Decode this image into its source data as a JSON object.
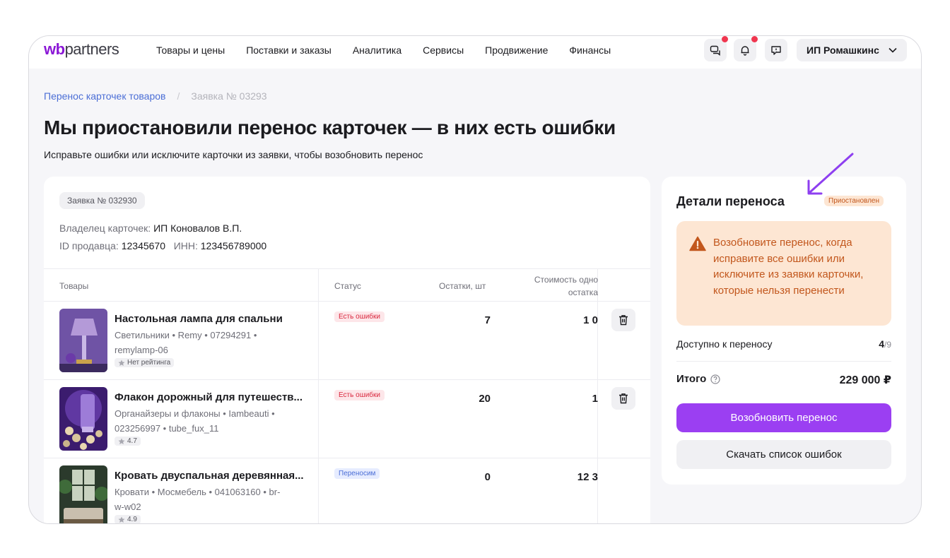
{
  "header": {
    "logo_wb": "wb",
    "logo_partners": "partners",
    "nav": [
      "Товары и цены",
      "Поставки и заказы",
      "Аналитика",
      "Сервисы",
      "Продвижение",
      "Финансы"
    ],
    "user_name": "ИП Ромашкинс",
    "icons": [
      "chat-icon",
      "bell-icon",
      "support-icon",
      "chevron-down-icon"
    ],
    "notification_color": "#f0364f"
  },
  "breadcrumb": {
    "parent": "Перенос карточек товаров",
    "separator": "/",
    "current": "Заявка № 03293"
  },
  "page": {
    "title": "Мы приостановили перенос карточек — в них есть ошибки",
    "subtitle": "Исправьте ошибки или исключите карточки из заявки, чтобы возобновить перенос"
  },
  "request": {
    "badge": "Заявка № 032930",
    "owner_label": "Владелец карточек:",
    "owner_value": "ИП Коновалов В.П.",
    "seller_id_label": "ID продавца:",
    "seller_id_value": "12345670",
    "inn_label": "ИНН:",
    "inn_value": "123456789000"
  },
  "table": {
    "columns": {
      "products": "Товары",
      "status": "Статус",
      "stock": "Остатки, шт",
      "cost_line1": "Стоимость одно",
      "cost_line2": "остатка"
    },
    "rows": [
      {
        "name": "Настольная лампа для спальни",
        "meta": "Светильники • Remy • 07294291 • remylamp-06",
        "rating": "Нет рейтинга",
        "status": "Есть ошибки",
        "stock": "7",
        "cost": "1 0",
        "has_delete": true
      },
      {
        "name": "Флакон дорожный для путешеств...",
        "meta": "Органайзеры и флаконы • Iambeauti • 023256997 • tube_fux_11",
        "rating": "4.7",
        "status": "Есть ошибки",
        "stock": "20",
        "cost": "1",
        "has_delete": true
      },
      {
        "name": "Кровать двуспальная деревянная...",
        "meta": "Кровати • Мосмебель • 041063160 • br-w-w02",
        "rating": "4.9",
        "status": "Переносим",
        "stock": "0",
        "cost": "12 3",
        "has_delete": false
      }
    ]
  },
  "details": {
    "title": "Детали переноса",
    "badge": "Приостановлен",
    "alert": "Возобновите перенос, когда исправите все ошибки или исключите из заявки карточки, которые нельзя перенести",
    "available_label": "Доступно к переносу",
    "available_value": "4",
    "available_total": "/9",
    "total_label": "Итого",
    "total_value": "229 000 ₽",
    "resume_button": "Возобновить перенос",
    "download_button": "Скачать список ошибок",
    "accent_color": "#9b3ff2",
    "warning_color": "#c2571d"
  }
}
